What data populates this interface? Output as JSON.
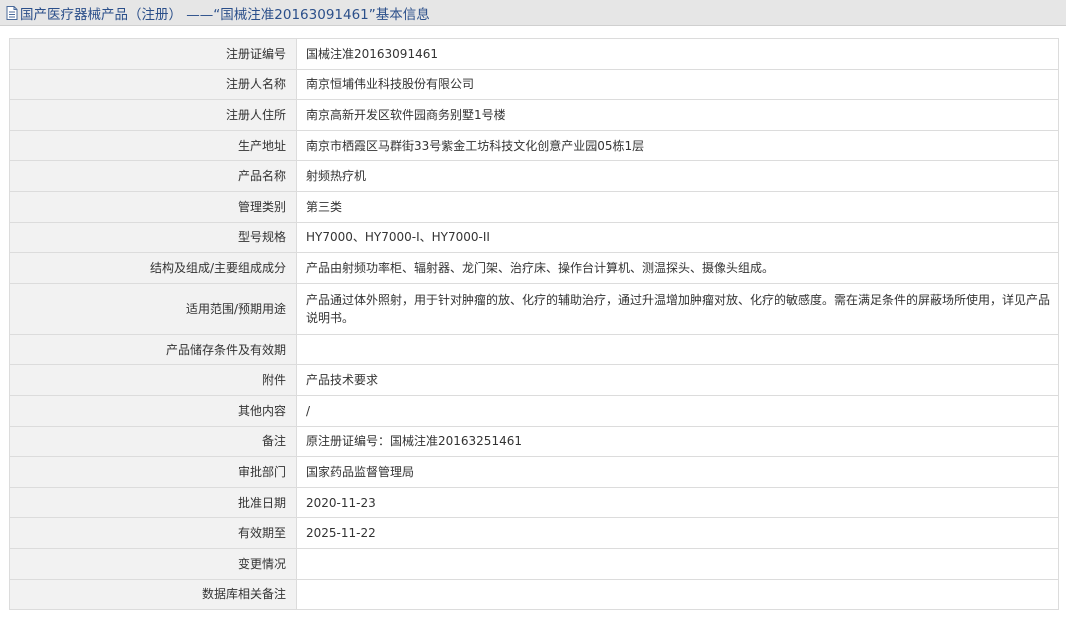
{
  "page": {
    "title": "国产医疗器械产品（注册） ——“国械注准20163091461”基本信息"
  },
  "icons": {
    "title_icon": "document-icon"
  },
  "colors": {
    "title_text": "#2b4f8a",
    "title_bg": "#e6e6e6",
    "label_bg": "#f2f2f2",
    "border": "#dcdcdc"
  },
  "rows": [
    {
      "label": "注册证编号",
      "value": "国械注准20163091461"
    },
    {
      "label": "注册人名称",
      "value": "南京恒埔伟业科技股份有限公司"
    },
    {
      "label": "注册人住所",
      "value": "南京高新开发区软件园商务别墅1号楼"
    },
    {
      "label": "生产地址",
      "value": "南京市栖霞区马群街33号紫金工坊科技文化创意产业园05栋1层"
    },
    {
      "label": "产品名称",
      "value": "射频热疗机"
    },
    {
      "label": "管理类别",
      "value": "第三类"
    },
    {
      "label": "型号规格",
      "value": "HY7000、HY7000-I、HY7000-II"
    },
    {
      "label": "结构及组成/主要组成成分",
      "value": "产品由射频功率柜、辐射器、龙门架、治疗床、操作台计算机、测温探头、摄像头组成。"
    },
    {
      "label": "适用范围/预期用途",
      "value": "产品通过体外照射，用于针对肿瘤的放、化疗的辅助治疗，通过升温增加肿瘤对放、化疗的敏感度。需在满足条件的屏蔽场所使用，详见产品说明书。"
    },
    {
      "label": "产品储存条件及有效期",
      "value": ""
    },
    {
      "label": "附件",
      "value": "产品技术要求"
    },
    {
      "label": "其他内容",
      "value": "/"
    },
    {
      "label": "备注",
      "value": "原注册证编号：国械注准20163251461"
    },
    {
      "label": "审批部门",
      "value": "国家药品监督管理局"
    },
    {
      "label": "批准日期",
      "value": "2020-11-23"
    },
    {
      "label": "有效期至",
      "value": "2025-11-22"
    },
    {
      "label": "变更情况",
      "value": ""
    },
    {
      "label": "数据库相关备注",
      "value": ""
    }
  ]
}
